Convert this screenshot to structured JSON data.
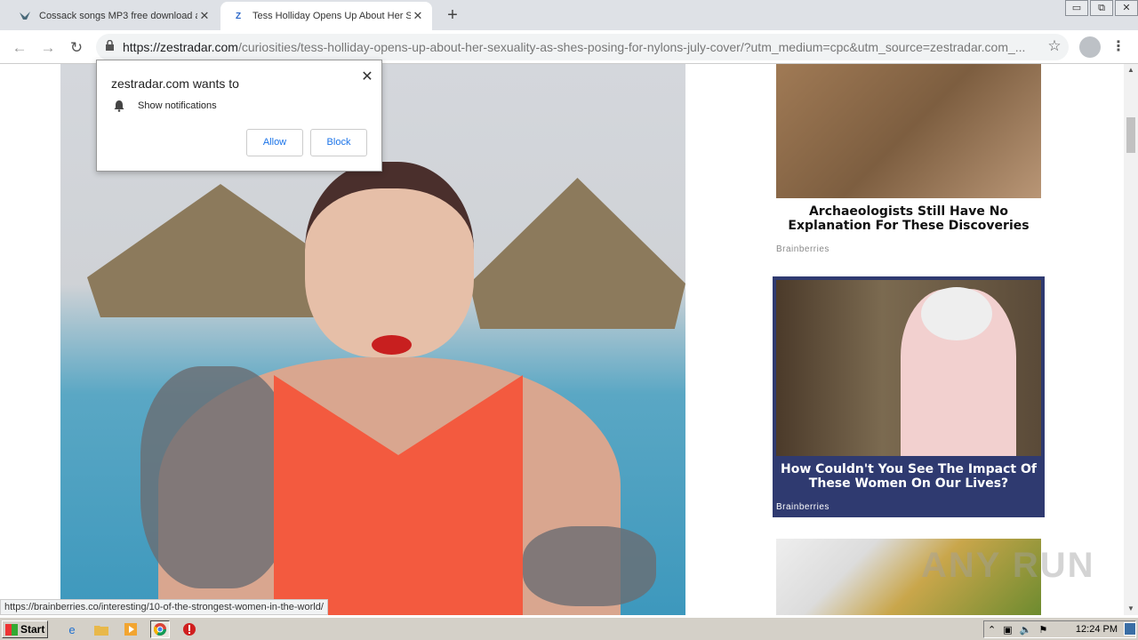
{
  "tabs": [
    {
      "title": "Cossack songs MP3 free download a",
      "favicon": "bird-icon"
    },
    {
      "title": "Tess Holliday Opens Up About Her Se",
      "favicon": "Z"
    }
  ],
  "new_tab": "+",
  "window_controls": {
    "minimize": "▭",
    "restore": "⧉",
    "close": "✕"
  },
  "toolbar": {
    "url_host": "https://zestradar.com",
    "url_path": "/curiosities/tess-holliday-opens-up-about-her-sexuality-as-shes-posing-for-nylons-july-cover/?utm_medium=cpc&utm_source=zestradar.com_..."
  },
  "notification_popup": {
    "title": "zestradar.com wants to",
    "permission": "Show notifications",
    "allow_label": "Allow",
    "block_label": "Block"
  },
  "sidebar": {
    "card1": {
      "title": "Archaeologists Still Have No Explanation For These Discoveries",
      "source": "Brainberries"
    },
    "card2": {
      "title": "How Couldn't You See The Impact Of These Women On Our Lives?",
      "source": "Brainberries"
    }
  },
  "watermark": "ANY RUN",
  "status_url": "https://brainberries.co/interesting/10-of-the-strongest-women-in-the-world/",
  "taskbar": {
    "start_label": "Start",
    "clock": "12:24 PM"
  }
}
